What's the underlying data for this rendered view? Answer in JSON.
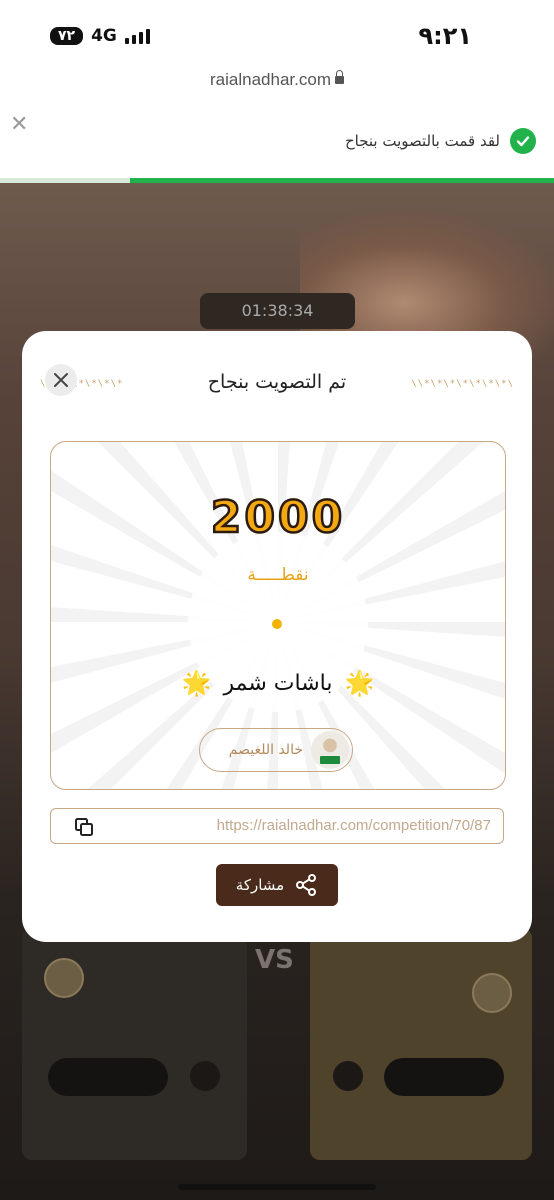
{
  "status_bar": {
    "time": "٩:٢١",
    "network": "4G",
    "battery": "٧٢"
  },
  "browser": {
    "url": "raialnadhar.com"
  },
  "toast": {
    "message": "لقد قمت بالتصويت بنجاح",
    "close_glyph": "✕",
    "progress": 0.765,
    "color": "#22b24c"
  },
  "background": {
    "timer": "01:38:34",
    "vs": "VS"
  },
  "modal": {
    "title": "تم التصويت بنجاح",
    "decoration_left": "\\\\*\\*\\*\\*\\*\\*",
    "decoration_right": "\\\\*\\*\\*\\*\\*\\*\\*\\",
    "points": "2000",
    "points_unit": "نقطـــــة",
    "team": "باشات شمر",
    "star": "🌟",
    "voter_name": "خالد اللغيصم",
    "link": "https://raialnadhar.com/competition/70/87",
    "share_label": "مشاركة",
    "accent_color": "#f4a812",
    "button_color": "#4a2a1a"
  }
}
